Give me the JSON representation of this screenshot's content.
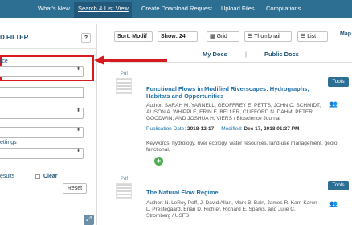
{
  "topnav": {
    "items": [
      "What's New",
      "Search & List View",
      "Create Download Request",
      "Upload Files",
      "Compilations"
    ],
    "active_index": 1
  },
  "sidebar": {
    "title": "D FILTER",
    "help_label": "?",
    "source_label": "rce",
    "settings_label": "ettings",
    "results_label": "esults",
    "clear_label": "Clear",
    "reset_label": "Reset",
    "caret": "⬍"
  },
  "toolbar": {
    "sort_label": "Sort: Modif",
    "show_label": "Show: 24",
    "grid_label": "Grid",
    "thumbnail_label": "Thumbnail",
    "list_label": "List",
    "map_label": "Map"
  },
  "tabs": {
    "my_docs": "My Docs",
    "separator": "|",
    "public_docs": "Public Docs"
  },
  "results": [
    {
      "type_label": "Pdf",
      "title_line1": "Functional Flows in Modified Riverscapes: Hydrographs,",
      "title_line2": "Habitats and Opportunities",
      "author_line1": "Author: SARAH M. YARNELL, GEOFFREY E. PETTS, JOHN C. SCHMIDT,",
      "author_line2": "ALISON A. WHIPPLE, ERIN E. BELLER, CLIFFORD N. DAHM, PETER",
      "author_line3": "GOODWIN, AND JOSHUA H. VIERS / Bioscience Journal",
      "pub_date_label": "Publication Date:",
      "pub_date": "2018-12-17",
      "modified_label": "Modified:",
      "modified": "Dec 17, 2018 01:37 PM",
      "keywords_line1": "Keywords: hydrology, river ecology, water resources, land-use management, geolo",
      "keywords_line2": "functional,",
      "tools_label": "Tools"
    },
    {
      "type_label": "Pdf",
      "title_line1": "The Natural Flow Regime",
      "author_line1": "Author: N. LeRoy Poff, J. David Allan, Mark B. Bain, James R. Karr, Karen",
      "author_line2": "L. Prestegaard, Brian D. Richter, Richard E. Sparks, and Julie C.",
      "author_line3": "Stromberg / USFS",
      "tools_label": "Tools"
    }
  ],
  "icons": {
    "people": "👥",
    "add": "+",
    "expand": "⤢"
  },
  "colors": {
    "nav_bg": "#2d6e93",
    "accent": "#1d5273",
    "highlight": "#d71920"
  }
}
